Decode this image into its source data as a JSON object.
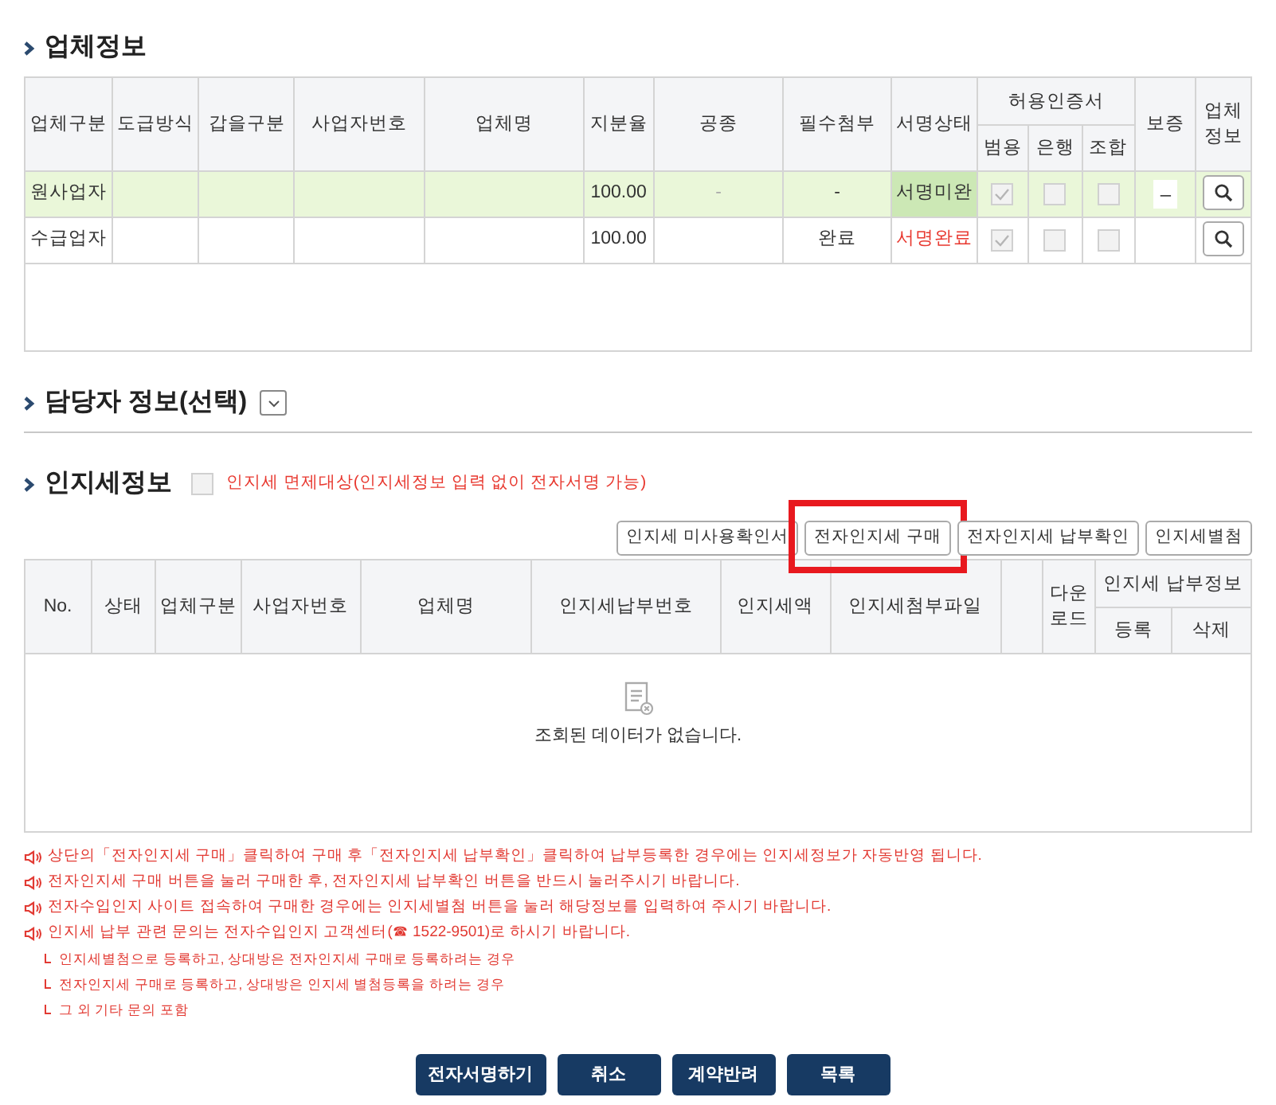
{
  "company_info": {
    "title": "업체정보",
    "columns": [
      "업체구분",
      "도급방식",
      "갑을구분",
      "사업자번호",
      "업체명",
      "지분율",
      "공종",
      "필수첨부",
      "서명상태"
    ],
    "cert_group": {
      "label": "허용인증서",
      "columns": [
        "범용",
        "은행",
        "조합"
      ]
    },
    "tail_columns": [
      "보증",
      "업체정보"
    ],
    "rows": [
      {
        "selected": true,
        "type": "원사업자",
        "share": "100.00",
        "work_type": "-",
        "required_attachment": "-",
        "sign_status": "서명미완",
        "signed": false,
        "certs": [
          {
            "checked": true
          },
          {
            "checked": false
          },
          {
            "checked": false
          }
        ],
        "guarantee": "–"
      },
      {
        "selected": false,
        "type": "수급업자",
        "share": "100.00",
        "required_attachment": "완료",
        "sign_status": "서명완료",
        "signed": true,
        "certs": [
          {
            "checked": true
          },
          {
            "checked": false
          },
          {
            "checked": false
          }
        ]
      }
    ]
  },
  "contact_info": {
    "title": "담당자 정보(선택)",
    "expanded": false
  },
  "stamp_tax": {
    "title": "인지세정보",
    "exempt": {
      "label": "인지세 면제대상(인지세정보 입력 없이 전자서명 가능)",
      "checked": false
    },
    "buttons": [
      {
        "label": "인지세 미사용확인서",
        "highlighted": false
      },
      {
        "label": "전자인지세 구매",
        "highlighted": true
      },
      {
        "label": "전자인지세 납부확인",
        "highlighted": false
      },
      {
        "label": "인지세별첨",
        "highlighted": false
      }
    ],
    "columns": [
      "No.",
      "상태",
      "업체구분",
      "사업자번호",
      "업체명",
      "인지세납부번호",
      "인지세액",
      "인지세첨부파일"
    ],
    "download_label": "다운로드",
    "payment_group": {
      "label": "인지세 납부정보",
      "columns": [
        "등록",
        "삭제"
      ]
    },
    "empty_message": "조회된 데이터가 없습니다.",
    "notes": [
      {
        "kind": "main",
        "text": "상단의「전자인지세 구매」클릭하여 구매 후「전자인지세 납부확인」클릭하여 납부등록한 경우에는 인지세정보가 자동반영 됩니다."
      },
      {
        "kind": "main",
        "text": "전자인지세 구매 버튼을 눌러 구매한 후, 전자인지세 납부확인 버튼을 반드시 눌러주시기 바랍니다."
      },
      {
        "kind": "main",
        "text": "전자수입인지 사이트 접속하여 구매한 경우에는 인지세별첨 버튼을 눌러 해당정보를 입력하여 주시기 바랍니다."
      },
      {
        "kind": "main",
        "text": "인지세 납부 관련 문의는 전자수입인지 고객센터(☎ 1522-9501)로 하시기 바랍니다."
      },
      {
        "kind": "sub",
        "text": "인지세별첨으로 등록하고, 상대방은 전자인지세 구매로 등록하려는 경우"
      },
      {
        "kind": "sub",
        "text": "전자인지세 구매로 등록하고, 상대방은 인지세 별첨등록을 하려는 경우"
      },
      {
        "kind": "sub",
        "text": "그 외 기타 문의 포함"
      }
    ]
  },
  "footer_buttons": [
    "전자서명하기",
    "취소",
    "계약반려",
    "목록"
  ]
}
